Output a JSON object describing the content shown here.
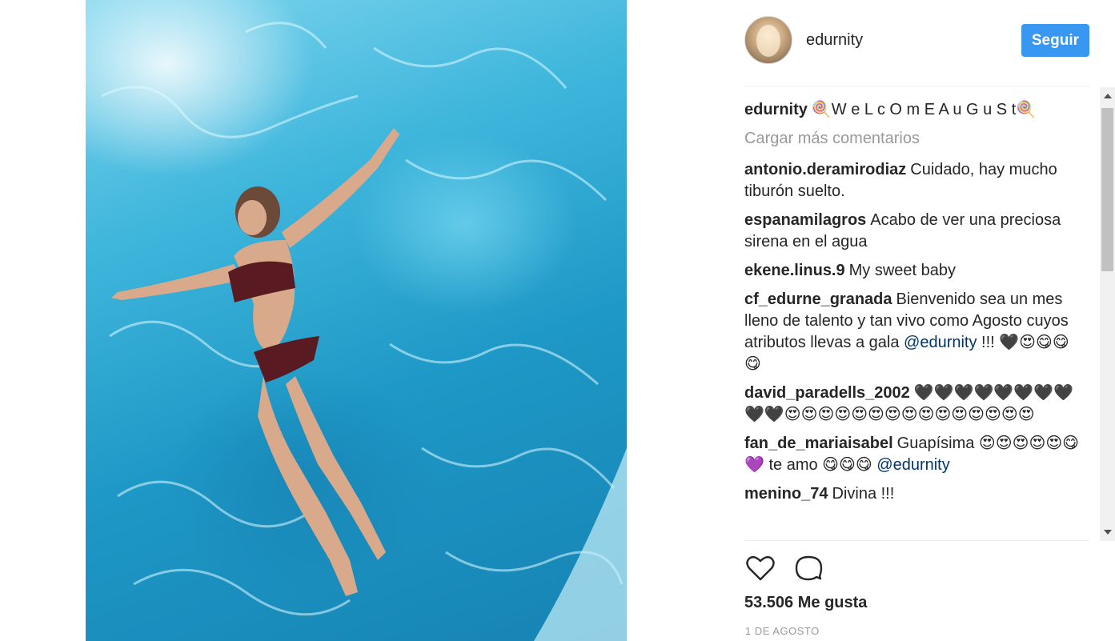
{
  "post": {
    "author": "edurnity",
    "follow_label": "Seguir",
    "caption": "🍭W e L c O m E A u G u S t🍭",
    "load_more": "Cargar más comentarios",
    "likes": "53.506 Me gusta",
    "date": "1 DE AGOSTO"
  },
  "comments": [
    {
      "user": "antonio.deramirodiaz",
      "text": "Cuidado, hay mucho tiburón suelto."
    },
    {
      "user": "espanamilagros",
      "text": "Acabo de ver una preciosa sirena en el agua"
    },
    {
      "user": "ekene.linus.9",
      "text": "My sweet baby"
    },
    {
      "user": "cf_edurne_granada",
      "text": "Bienvenido sea un mes lleno de talento y tan vivo como Agosto cuyos atributos llevas a gala ",
      "mention": "@edurnity",
      "suffix": " !!! 🖤😍😋😋😋"
    },
    {
      "user": "david_paradells_2002",
      "text": "🖤🖤🖤🖤🖤🖤🖤🖤🖤🖤😍😍😍😍😍😍😍😍😍😍😍😍😍😍😍"
    },
    {
      "user": "fan_de_mariaisabel",
      "text": "Guapísima 😍😍😍😍😍😋💜 te amo 😋😋😋 ",
      "mention": "@edurnity",
      "suffix": ""
    },
    {
      "user": "menino_74",
      "text": "Divina !!!"
    }
  ],
  "icons": {
    "like": "heart-outline-icon",
    "comment": "speech-bubble-icon"
  },
  "colors": {
    "follow_button": "#3897f0",
    "mention": "#003569",
    "muted": "#999999"
  }
}
